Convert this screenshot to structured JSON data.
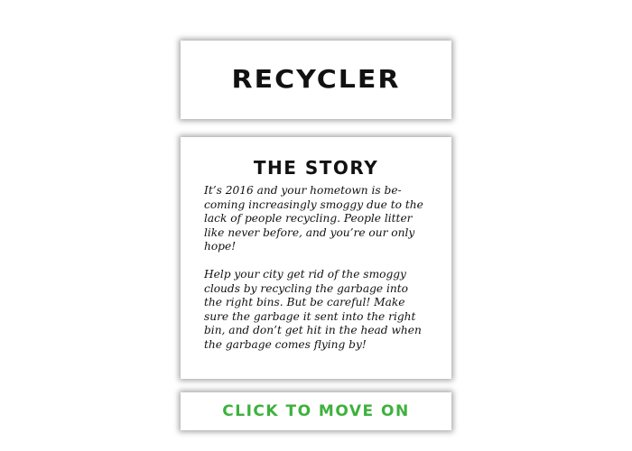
{
  "title_card": {
    "title": "RECYCLER"
  },
  "story_card": {
    "heading": "THE STORY",
    "paragraphs": [
      "It’s 2016 and your hometown is be-coming increasingly smoggy due to the lack of people recycling. People litter like never before, and you’re our only hope!",
      "Help your city get rid of the smoggy clouds by recycling the garbage into the right bins. But be careful! Make sure the garbage it sent into the right bin, and don’t get hit in the head when the garbage comes flying by!"
    ]
  },
  "cta": {
    "label": "CLICK TO MOVE ON",
    "color": "#3db13d"
  }
}
